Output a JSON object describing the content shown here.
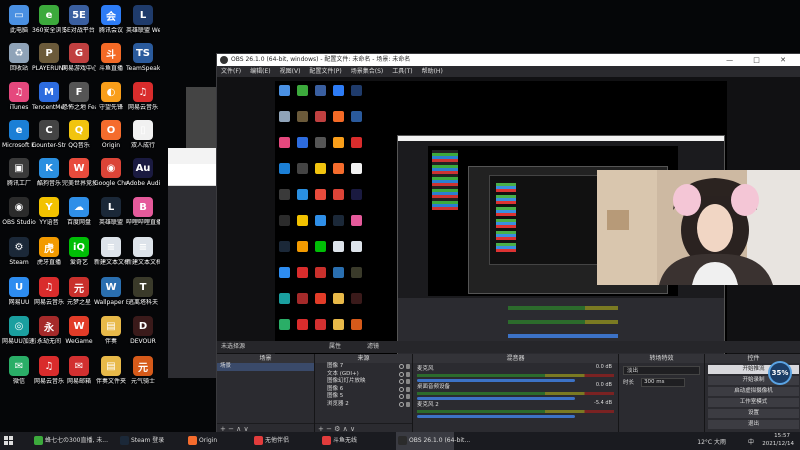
{
  "desktop_icons": [
    {
      "label": "此电脑",
      "color": "#4a90e2",
      "glyph": "▭"
    },
    {
      "label": "回收站",
      "color": "#8fa3b8",
      "glyph": "♻"
    },
    {
      "label": "iTunes",
      "color": "#e5487d",
      "glyph": "♫"
    },
    {
      "label": "Microsoft Edge",
      "color": "#1b7fd6",
      "glyph": "e"
    },
    {
      "label": "腾讯工厂",
      "color": "#3a3a3a",
      "glyph": "▣"
    },
    {
      "label": "OBS Studio",
      "color": "#2b2b2b",
      "glyph": "◉"
    },
    {
      "label": "Steam",
      "color": "#1b2838",
      "glyph": "⚙"
    },
    {
      "label": "网易UU",
      "color": "#2d8cf0",
      "glyph": "U"
    },
    {
      "label": "网易UU加速器",
      "color": "#1a9f9f",
      "glyph": "◎"
    },
    {
      "label": "微信",
      "color": "#2aae67",
      "glyph": "✉"
    },
    {
      "label": "360安全浏览器",
      "color": "#3caa3c",
      "glyph": "e"
    },
    {
      "label": "PLAYERUNKNOWN BATTLEGR...",
      "color": "#6b5a3a",
      "glyph": "P"
    },
    {
      "label": "TencentMe...",
      "color": "#2d6cdf",
      "glyph": "M"
    },
    {
      "label": "Counter-Strike Global Off...",
      "color": "#444",
      "glyph": "C"
    },
    {
      "label": "酷狗音乐",
      "color": "#2a8fe0",
      "glyph": "K"
    },
    {
      "label": "YY语音",
      "color": "#f2c200",
      "glyph": "Y"
    },
    {
      "label": "虎牙直播",
      "color": "#f29a00",
      "glyph": "虎"
    },
    {
      "label": "网易云音乐",
      "color": "#d92c2c",
      "glyph": "♫"
    },
    {
      "label": "永劫无间",
      "color": "#a52a2a",
      "glyph": "永"
    },
    {
      "label": "网易云音乐",
      "color": "#d92c2c",
      "glyph": "♫"
    },
    {
      "label": "5E对战平台",
      "color": "#3a5fa0",
      "glyph": "5E"
    },
    {
      "label": "网易游戏中心 BATTLEGR...",
      "color": "#c04040",
      "glyph": "G"
    },
    {
      "label": "恐怖之地 Fear sur...",
      "color": "#555",
      "glyph": "F"
    },
    {
      "label": "QQ音乐",
      "color": "#f1c40f",
      "glyph": "Q"
    },
    {
      "label": "完美世界竞技平台",
      "color": "#e84b3c",
      "glyph": "W"
    },
    {
      "label": "百度网盘",
      "color": "#2f8fe8",
      "glyph": "☁"
    },
    {
      "label": "爱奇艺",
      "color": "#00be06",
      "glyph": "iQ"
    },
    {
      "label": "元梦之星",
      "color": "#c9302c",
      "glyph": "元"
    },
    {
      "label": "WeGame",
      "color": "#e23c28",
      "glyph": "W"
    },
    {
      "label": "网易邮箱",
      "color": "#d23030",
      "glyph": "✉"
    },
    {
      "label": "腾讯会议",
      "color": "#2d7cf6",
      "glyph": "会"
    },
    {
      "label": "斗鱼直播",
      "color": "#f46a26",
      "glyph": "斗"
    },
    {
      "label": "守望先锋",
      "color": "#f99e1a",
      "glyph": "◐"
    },
    {
      "label": "Origin",
      "color": "#f56c2d",
      "glyph": "O"
    },
    {
      "label": "Google Chrome",
      "color": "#db4437",
      "glyph": "◉"
    },
    {
      "label": "英雄联盟",
      "color": "#1b2838",
      "glyph": "L"
    },
    {
      "label": "新建文本文档",
      "color": "#dde3ea",
      "glyph": "≡"
    },
    {
      "label": "Wallpaper Engine:...",
      "color": "#2a6fb0",
      "glyph": "W"
    },
    {
      "label": "伴奏",
      "color": "#e8b949",
      "glyph": "▤"
    },
    {
      "label": "伴奏文件夹",
      "color": "#e8b949",
      "glyph": "▤"
    },
    {
      "label": "英雄联盟 WeGame版",
      "color": "#1f3b6b",
      "glyph": "L"
    },
    {
      "label": "TeamSpeak 3",
      "color": "#2a5a9c",
      "glyph": "TS"
    },
    {
      "label": "网易云音乐",
      "color": "#d92c2c",
      "glyph": "♫"
    },
    {
      "label": "双人成行",
      "color": "#f1f1f1",
      "glyph": "▯"
    },
    {
      "label": "Adobe Audit...",
      "color": "#1a1a40",
      "glyph": "Au"
    },
    {
      "label": "哔哩哔哩直播",
      "color": "#e55a9b",
      "glyph": "B"
    },
    {
      "label": "新建文本文档",
      "color": "#dde3ea",
      "glyph": "≡"
    },
    {
      "label": "逃离塔科夫",
      "color": "#3a3a2a",
      "glyph": "T"
    },
    {
      "label": "DEVOUR",
      "color": "#3a1a1a",
      "glyph": "D"
    },
    {
      "label": "元气骑士",
      "color": "#d65a1a",
      "glyph": "元"
    }
  ],
  "obs": {
    "title": "OBS 26.1.0 (64-bit, windows) - 配置文件: 未命名 - 场景: 未命名",
    "menu": [
      "文件(F)",
      "编辑(E)",
      "视图(V)",
      "配置文件(P)",
      "场景集合(S)",
      "工具(T)",
      "帮助(H)"
    ],
    "scene_bar": {
      "label": "未选择源",
      "props": "属性",
      "filters": "滤镜"
    },
    "docks": {
      "scenes": {
        "header": "场景",
        "items": [
          "场景"
        ]
      },
      "sources": {
        "header": "来源",
        "items": [
          "图像 7",
          "文本 (GDI+)",
          "图像幻灯片放映",
          "图像 6",
          "图像 5",
          "浏览器 2"
        ]
      },
      "mixer": {
        "header": "混音器",
        "tracks": [
          {
            "name": "麦克风",
            "db": "0.0 dB"
          },
          {
            "name": "桌面音频设备",
            "db": "0.0 dB"
          },
          {
            "name": "麦克风 2",
            "db": "-5.4 dB"
          }
        ]
      },
      "transitions": {
        "header": "转场特效",
        "type": "淡出",
        "duration_label": "时长",
        "duration": "300 ms"
      },
      "controls": {
        "header": "控件",
        "buttons": [
          "开始推流",
          "开始录制",
          "启动虚拟摄像机",
          "工作室模式",
          "设置",
          "退出"
        ]
      }
    },
    "status": "LIVE: 00:00:00  REC: 00:00:00  CPU: 1.4%, 60.00 fps"
  },
  "webcam": {
    "caption": "35%"
  },
  "taskbar": {
    "items": [
      {
        "label": "蜂七七の300直播, 未...",
        "color": "#3caa3c"
      },
      {
        "label": "Steam 登录",
        "color": "#1b2838"
      },
      {
        "label": "Origin",
        "color": "#f56c2d"
      },
      {
        "label": "无他伴侣",
        "color": "#e23c3c"
      },
      {
        "label": "斗鱼无线",
        "color": "#e23c3c"
      },
      {
        "label": "OBS 26.1.0 (64-bit...",
        "color": "#2b2b2b"
      }
    ],
    "weather": "12°C 大雨",
    "time": "15:57",
    "date": "2021/12/14",
    "lang": "中"
  }
}
